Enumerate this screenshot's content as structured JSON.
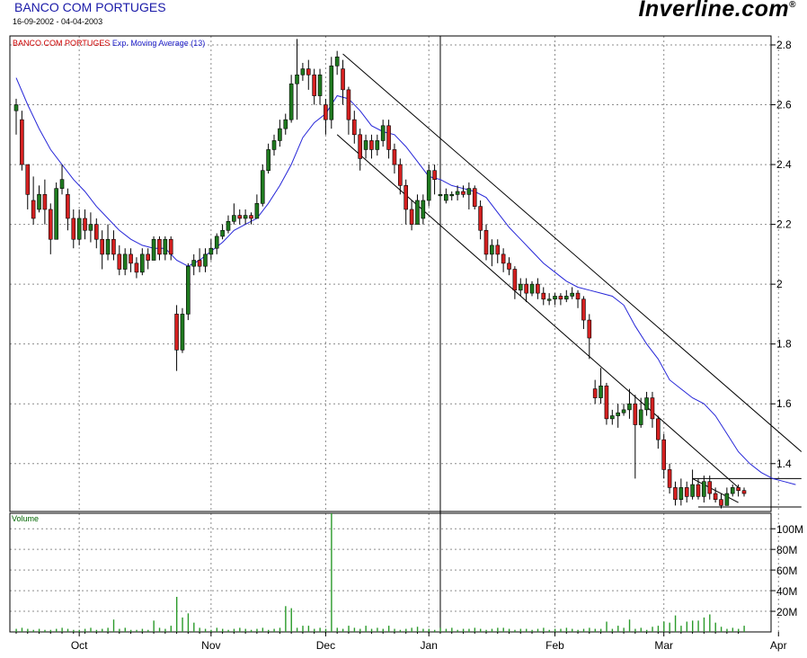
{
  "header": {
    "title": "BANCO COM PORTUGES",
    "date_range": "16-09-2002 - 04-04-2003",
    "brand": "Inverline.com",
    "brand_mark": "®"
  },
  "colors": {
    "up": "#1f7a1f",
    "down": "#d42020",
    "ema": "#2626d8",
    "volume": "#2a9a2a",
    "legend_name": "#cc0000",
    "legend_indicator": "#2222cc",
    "volume_label": "#006600"
  },
  "chart_data": {
    "type": "candlestick",
    "legend": {
      "name": "BANCO COM PORTUGES",
      "indicator": "Exp. Moving Average (13)"
    },
    "price_axis": {
      "ticks": [
        1.4,
        1.6,
        1.8,
        2.0,
        2.2,
        2.4,
        2.6,
        2.8
      ],
      "tick_labels": [
        "1.4",
        "1.6",
        "1.8",
        "2",
        "2.2",
        "2.4",
        "2.6",
        "2.8"
      ],
      "range": [
        1.24,
        2.83
      ]
    },
    "volume_axis": {
      "label": "Volume",
      "ticks": [
        20,
        40,
        60,
        80,
        100
      ],
      "tick_labels": [
        "20M",
        "40M",
        "60M",
        "80M",
        "100M"
      ],
      "range": [
        0,
        115
      ]
    },
    "months": [
      {
        "label": "Oct",
        "index": 11
      },
      {
        "label": "Nov",
        "index": 34
      },
      {
        "label": "Dec",
        "index": 54
      },
      {
        "label": "Jan",
        "index": 72
      },
      {
        "label": "Feb",
        "index": 94
      },
      {
        "label": "Mar",
        "index": 113
      },
      {
        "label": "Apr",
        "index": 133
      }
    ],
    "vertical_marker_index": 74,
    "candles": [
      [
        2.58,
        2.6,
        2.62,
        2.5
      ],
      [
        2.55,
        2.4,
        2.58,
        2.38
      ],
      [
        2.4,
        2.3,
        2.4,
        2.25
      ],
      [
        2.28,
        2.22,
        2.36,
        2.2
      ],
      [
        2.25,
        2.3,
        2.33,
        2.24
      ],
      [
        2.3,
        2.25,
        2.35,
        2.2
      ],
      [
        2.25,
        2.15,
        2.27,
        2.1
      ],
      [
        2.15,
        2.32,
        2.34,
        2.15
      ],
      [
        2.32,
        2.35,
        2.4,
        2.3
      ],
      [
        2.3,
        2.22,
        2.32,
        2.18
      ],
      [
        2.22,
        2.15,
        2.25,
        2.12
      ],
      [
        2.15,
        2.22,
        2.25,
        2.13
      ],
      [
        2.22,
        2.18,
        2.25,
        2.15
      ],
      [
        2.18,
        2.2,
        2.24,
        2.14
      ],
      [
        2.2,
        2.15,
        2.22,
        2.12
      ],
      [
        2.15,
        2.1,
        2.18,
        2.05
      ],
      [
        2.1,
        2.15,
        2.2,
        2.08
      ],
      [
        2.15,
        2.1,
        2.18,
        2.08
      ],
      [
        2.1,
        2.05,
        2.13,
        2.03
      ],
      [
        2.05,
        2.1,
        2.12,
        2.03
      ],
      [
        2.1,
        2.07,
        2.12,
        2.04
      ],
      [
        2.07,
        2.04,
        2.09,
        2.02
      ],
      [
        2.04,
        2.1,
        2.12,
        2.03
      ],
      [
        2.1,
        2.08,
        2.12,
        2.05
      ],
      [
        2.08,
        2.15,
        2.16,
        2.08
      ],
      [
        2.15,
        2.1,
        2.16,
        2.08
      ],
      [
        2.1,
        2.15,
        2.16,
        2.08
      ],
      [
        2.15,
        2.1,
        2.16,
        2.08
      ],
      [
        1.9,
        1.78,
        1.93,
        1.71
      ],
      [
        1.78,
        1.9,
        1.92,
        1.77
      ],
      [
        1.9,
        2.06,
        2.07,
        1.88
      ],
      [
        2.06,
        2.08,
        2.1,
        2.03
      ],
      [
        2.08,
        2.06,
        2.12,
        2.04
      ],
      [
        2.06,
        2.1,
        2.12,
        2.04
      ],
      [
        2.1,
        2.12,
        2.15,
        2.08
      ],
      [
        2.12,
        2.16,
        2.17,
        2.1
      ],
      [
        2.16,
        2.18,
        2.2,
        2.15
      ],
      [
        2.18,
        2.21,
        2.23,
        2.17
      ],
      [
        2.21,
        2.23,
        2.27,
        2.2
      ],
      [
        2.23,
        2.22,
        2.25,
        2.2
      ],
      [
        2.22,
        2.23,
        2.25,
        2.2
      ],
      [
        2.23,
        2.22,
        2.24,
        2.2
      ],
      [
        2.22,
        2.27,
        2.3,
        2.22
      ],
      [
        2.27,
        2.38,
        2.4,
        2.26
      ],
      [
        2.38,
        2.45,
        2.47,
        2.37
      ],
      [
        2.45,
        2.48,
        2.5,
        2.43
      ],
      [
        2.48,
        2.52,
        2.55,
        2.46
      ],
      [
        2.52,
        2.55,
        2.57,
        2.5
      ],
      [
        2.55,
        2.67,
        2.7,
        2.54
      ],
      [
        2.67,
        2.7,
        2.82,
        2.55
      ],
      [
        2.7,
        2.72,
        2.74,
        2.68
      ],
      [
        2.72,
        2.7,
        2.75,
        2.65
      ],
      [
        2.7,
        2.63,
        2.72,
        2.6
      ],
      [
        2.63,
        2.7,
        2.72,
        2.6
      ],
      [
        2.6,
        2.55,
        2.62,
        2.5
      ],
      [
        2.55,
        2.73,
        2.76,
        2.52
      ],
      [
        2.73,
        2.76,
        2.78,
        2.7
      ],
      [
        2.72,
        2.65,
        2.75,
        2.6
      ],
      [
        2.65,
        2.55,
        2.66,
        2.5
      ],
      [
        2.55,
        2.5,
        2.58,
        2.47
      ],
      [
        2.5,
        2.42,
        2.52,
        2.38
      ],
      [
        2.45,
        2.48,
        2.5,
        2.42
      ],
      [
        2.48,
        2.45,
        2.5,
        2.42
      ],
      [
        2.45,
        2.48,
        2.5,
        2.43
      ],
      [
        2.48,
        2.53,
        2.55,
        2.46
      ],
      [
        2.53,
        2.45,
        2.55,
        2.42
      ],
      [
        2.45,
        2.4,
        2.47,
        2.37
      ],
      [
        2.4,
        2.33,
        2.42,
        2.3
      ],
      [
        2.33,
        2.25,
        2.35,
        2.2
      ],
      [
        2.25,
        2.2,
        2.28,
        2.18
      ],
      [
        2.2,
        2.28,
        2.3,
        2.2
      ],
      [
        2.22,
        2.28,
        2.3,
        2.2
      ],
      [
        2.28,
        2.38,
        2.4,
        2.26
      ],
      [
        2.38,
        2.35,
        2.4,
        2.3
      ],
      [
        2.3,
        2.3,
        2.32,
        2.28
      ],
      [
        2.28,
        2.3,
        2.32,
        2.27
      ],
      [
        2.3,
        2.3,
        2.31,
        2.28
      ],
      [
        2.3,
        2.31,
        2.33,
        2.28
      ],
      [
        2.31,
        2.3,
        2.33,
        2.29
      ],
      [
        2.3,
        2.32,
        2.34,
        2.25
      ],
      [
        2.32,
        2.26,
        2.33,
        2.25
      ],
      [
        2.26,
        2.18,
        2.28,
        2.15
      ],
      [
        2.18,
        2.1,
        2.2,
        2.08
      ],
      [
        2.1,
        2.13,
        2.15,
        2.06
      ],
      [
        2.13,
        2.1,
        2.15,
        2.07
      ],
      [
        2.1,
        2.07,
        2.12,
        2.04
      ],
      [
        2.07,
        2.05,
        2.09,
        2.03
      ],
      [
        2.05,
        1.98,
        2.06,
        1.95
      ],
      [
        1.98,
        2.0,
        2.02,
        1.96
      ],
      [
        2.0,
        1.97,
        2.02,
        1.94
      ],
      [
        1.97,
        2.0,
        2.01,
        1.96
      ],
      [
        2.0,
        1.97,
        2.02,
        1.95
      ],
      [
        1.97,
        1.95,
        1.99,
        1.93
      ],
      [
        1.95,
        1.95,
        1.97,
        1.93
      ],
      [
        1.95,
        1.96,
        1.97,
        1.93
      ],
      [
        1.96,
        1.95,
        1.97,
        1.93
      ],
      [
        1.95,
        1.96,
        1.98,
        1.94
      ],
      [
        1.96,
        1.97,
        1.99,
        1.95
      ],
      [
        1.97,
        1.95,
        1.98,
        1.92
      ],
      [
        1.95,
        1.88,
        1.96,
        1.85
      ],
      [
        1.88,
        1.82,
        1.9,
        1.75
      ],
      [
        1.65,
        1.62,
        1.68,
        1.6
      ],
      [
        1.62,
        1.66,
        1.72,
        1.6
      ],
      [
        1.66,
        1.55,
        1.67,
        1.53
      ],
      [
        1.55,
        1.56,
        1.58,
        1.53
      ],
      [
        1.56,
        1.57,
        1.6,
        1.52
      ],
      [
        1.57,
        1.58,
        1.6,
        1.56
      ],
      [
        1.58,
        1.6,
        1.65,
        1.55
      ],
      [
        1.6,
        1.53,
        1.63,
        1.35
      ],
      [
        1.53,
        1.58,
        1.62,
        1.52
      ],
      [
        1.58,
        1.62,
        1.64,
        1.56
      ],
      [
        1.62,
        1.55,
        1.64,
        1.52
      ],
      [
        1.55,
        1.48,
        1.56,
        1.45
      ],
      [
        1.48,
        1.38,
        1.5,
        1.35
      ],
      [
        1.38,
        1.32,
        1.4,
        1.3
      ],
      [
        1.32,
        1.28,
        1.34,
        1.26
      ],
      [
        1.28,
        1.32,
        1.35,
        1.26
      ],
      [
        1.32,
        1.29,
        1.34,
        1.27
      ],
      [
        1.29,
        1.33,
        1.38,
        1.28
      ],
      [
        1.33,
        1.29,
        1.35,
        1.28
      ],
      [
        1.29,
        1.34,
        1.36,
        1.27
      ],
      [
        1.34,
        1.3,
        1.36,
        1.28
      ],
      [
        1.3,
        1.28,
        1.32,
        1.27
      ],
      [
        1.28,
        1.26,
        1.3,
        1.25
      ],
      [
        1.26,
        1.3,
        1.32,
        1.26
      ],
      [
        1.3,
        1.32,
        1.33,
        1.29
      ],
      [
        1.32,
        1.31,
        1.33,
        1.29
      ],
      [
        1.31,
        1.3,
        1.32,
        1.29
      ]
    ],
    "ema13": [
      [
        0,
        2.69
      ],
      [
        2,
        2.6
      ],
      [
        4,
        2.52
      ],
      [
        6,
        2.45
      ],
      [
        8,
        2.4
      ],
      [
        10,
        2.35
      ],
      [
        12,
        2.31
      ],
      [
        14,
        2.26
      ],
      [
        16,
        2.22
      ],
      [
        18,
        2.18
      ],
      [
        20,
        2.15
      ],
      [
        22,
        2.13
      ],
      [
        24,
        2.12
      ],
      [
        26,
        2.12
      ],
      [
        28,
        2.08
      ],
      [
        30,
        2.06
      ],
      [
        32,
        2.08
      ],
      [
        34,
        2.11
      ],
      [
        36,
        2.14
      ],
      [
        38,
        2.18
      ],
      [
        40,
        2.2
      ],
      [
        42,
        2.22
      ],
      [
        44,
        2.27
      ],
      [
        46,
        2.33
      ],
      [
        48,
        2.4
      ],
      [
        50,
        2.49
      ],
      [
        52,
        2.54
      ],
      [
        54,
        2.57
      ],
      [
        56,
        2.63
      ],
      [
        58,
        2.62
      ],
      [
        60,
        2.58
      ],
      [
        62,
        2.53
      ],
      [
        64,
        2.51
      ],
      [
        66,
        2.5
      ],
      [
        68,
        2.46
      ],
      [
        70,
        2.41
      ],
      [
        72,
        2.36
      ],
      [
        74,
        2.35
      ],
      [
        76,
        2.33
      ],
      [
        78,
        2.32
      ],
      [
        80,
        2.31
      ],
      [
        82,
        2.29
      ],
      [
        84,
        2.24
      ],
      [
        86,
        2.19
      ],
      [
        88,
        2.15
      ],
      [
        90,
        2.11
      ],
      [
        92,
        2.07
      ],
      [
        94,
        2.04
      ],
      [
        96,
        2.01
      ],
      [
        98,
        1.99
      ],
      [
        100,
        1.98
      ],
      [
        102,
        1.97
      ],
      [
        104,
        1.96
      ],
      [
        106,
        1.93
      ],
      [
        108,
        1.86
      ],
      [
        110,
        1.8
      ],
      [
        112,
        1.75
      ],
      [
        114,
        1.68
      ],
      [
        116,
        1.65
      ],
      [
        118,
        1.62
      ],
      [
        120,
        1.6
      ],
      [
        122,
        1.56
      ],
      [
        124,
        1.5
      ],
      [
        126,
        1.44
      ],
      [
        128,
        1.4
      ],
      [
        130,
        1.37
      ],
      [
        132,
        1.35
      ],
      [
        134,
        1.34
      ],
      [
        136,
        1.33
      ]
    ],
    "trendlines": [
      {
        "from": [
          57,
          2.77
        ],
        "to": [
          137,
          1.44
        ]
      },
      {
        "from": [
          56,
          2.5
        ],
        "to": [
          126,
          1.32
        ]
      },
      {
        "from": [
          118,
          1.35
        ],
        "to": [
          124,
          1.35
        ]
      },
      {
        "from": [
          124,
          1.35
        ],
        "to": [
          137,
          1.35
        ]
      },
      {
        "from": [
          118,
          1.35
        ],
        "to": [
          126,
          1.27
        ]
      },
      {
        "from": [
          119,
          1.255
        ],
        "to": [
          137,
          1.255
        ]
      }
    ],
    "volume": [
      3,
      4,
      3,
      2,
      3,
      2,
      2,
      3,
      4,
      3,
      2,
      2,
      3,
      4,
      2,
      3,
      4,
      12,
      3,
      4,
      2,
      2,
      3,
      2,
      11,
      4,
      3,
      6,
      34,
      14,
      18,
      9,
      4,
      3,
      2,
      4,
      3,
      2,
      3,
      4,
      3,
      2,
      3,
      4,
      2,
      3,
      4,
      25,
      23,
      4,
      6,
      6,
      3,
      4,
      3,
      115,
      4,
      3,
      6,
      4,
      3,
      6,
      3,
      4,
      3,
      6,
      3,
      2,
      3,
      4,
      5,
      3,
      3,
      2,
      4,
      3,
      4,
      2,
      3,
      3,
      4,
      3,
      2,
      3,
      4,
      4,
      3,
      2,
      3,
      3,
      2,
      3,
      4,
      2,
      3,
      3,
      4,
      3,
      2,
      3,
      4,
      3,
      3,
      10,
      3,
      6,
      4,
      12,
      3,
      4,
      2,
      5,
      6,
      10,
      9,
      16,
      6,
      10,
      11,
      11,
      14,
      17,
      9,
      5,
      3,
      4,
      3,
      6,
      3,
      2,
      3,
      4,
      3,
      2,
      2
    ]
  }
}
